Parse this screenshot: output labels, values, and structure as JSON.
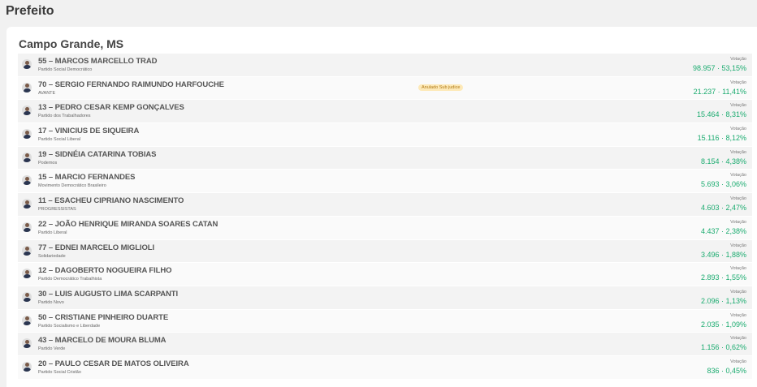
{
  "page": {
    "title": "Prefeito"
  },
  "city": "Campo Grande, MS",
  "vote_label": "Votação",
  "candidates": [
    {
      "name": "55 – MARCOS MARCELLO TRAD",
      "party": "Partido Social Democrático",
      "votes": "98.957 · 53,15%",
      "badge": ""
    },
    {
      "name": "70 – SERGIO FERNANDO RAIMUNDO HARFOUCHE",
      "party": "AVANTE",
      "votes": "21.237 · 11,41%",
      "badge": "Anulado Sub judice"
    },
    {
      "name": "13 – PEDRO CESAR KEMP GONÇALVES",
      "party": "Partido dos Trabalhadores",
      "votes": "15.464 · 8,31%",
      "badge": ""
    },
    {
      "name": "17 – VINICIUS DE SIQUEIRA",
      "party": "Partido Social Liberal",
      "votes": "15.116 · 8,12%",
      "badge": ""
    },
    {
      "name": "19 – SIDNÉIA CATARINA TOBIAS",
      "party": "Podemos",
      "votes": "8.154 · 4,38%",
      "badge": ""
    },
    {
      "name": "15 – MARCIO FERNANDES",
      "party": "Movimento Democrático Brasileiro",
      "votes": "5.693 · 3,06%",
      "badge": ""
    },
    {
      "name": "11 – ESACHEU CIPRIANO NASCIMENTO",
      "party": "PROGRESSISTAS",
      "votes": "4.603 · 2,47%",
      "badge": ""
    },
    {
      "name": "22 – JOÃO HENRIQUE MIRANDA SOARES CATAN",
      "party": "Partido Liberal",
      "votes": "4.437 · 2,38%",
      "badge": ""
    },
    {
      "name": "77 – EDNEI MARCELO MIGLIOLI",
      "party": "Solidariedade",
      "votes": "3.496 · 1,88%",
      "badge": ""
    },
    {
      "name": "12 – DAGOBERTO NOGUEIRA FILHO",
      "party": "Partido Democrático Trabalhista",
      "votes": "2.893 · 1,55%",
      "badge": ""
    },
    {
      "name": "30 – LUIS AUGUSTO LIMA SCARPANTI",
      "party": "Partido Novo",
      "votes": "2.096 · 1,13%",
      "badge": ""
    },
    {
      "name": "50 – CRISTIANE PINHEIRO DUARTE",
      "party": "Partido Socialismo e Liberdade",
      "votes": "2.035 · 1,09%",
      "badge": ""
    },
    {
      "name": "43 – MARCELO DE MOURA BLUMA",
      "party": "Partido Verde",
      "votes": "1.156 · 0,62%",
      "badge": ""
    },
    {
      "name": "20 – PAULO CESAR DE MATOS OLIVEIRA",
      "party": "Partido Social Cristão",
      "votes": "836 · 0,45%",
      "badge": ""
    }
  ],
  "colors": {
    "votes": "#1aab6f",
    "badge_bg": "#fde9b8",
    "badge_text": "#b07a16"
  }
}
